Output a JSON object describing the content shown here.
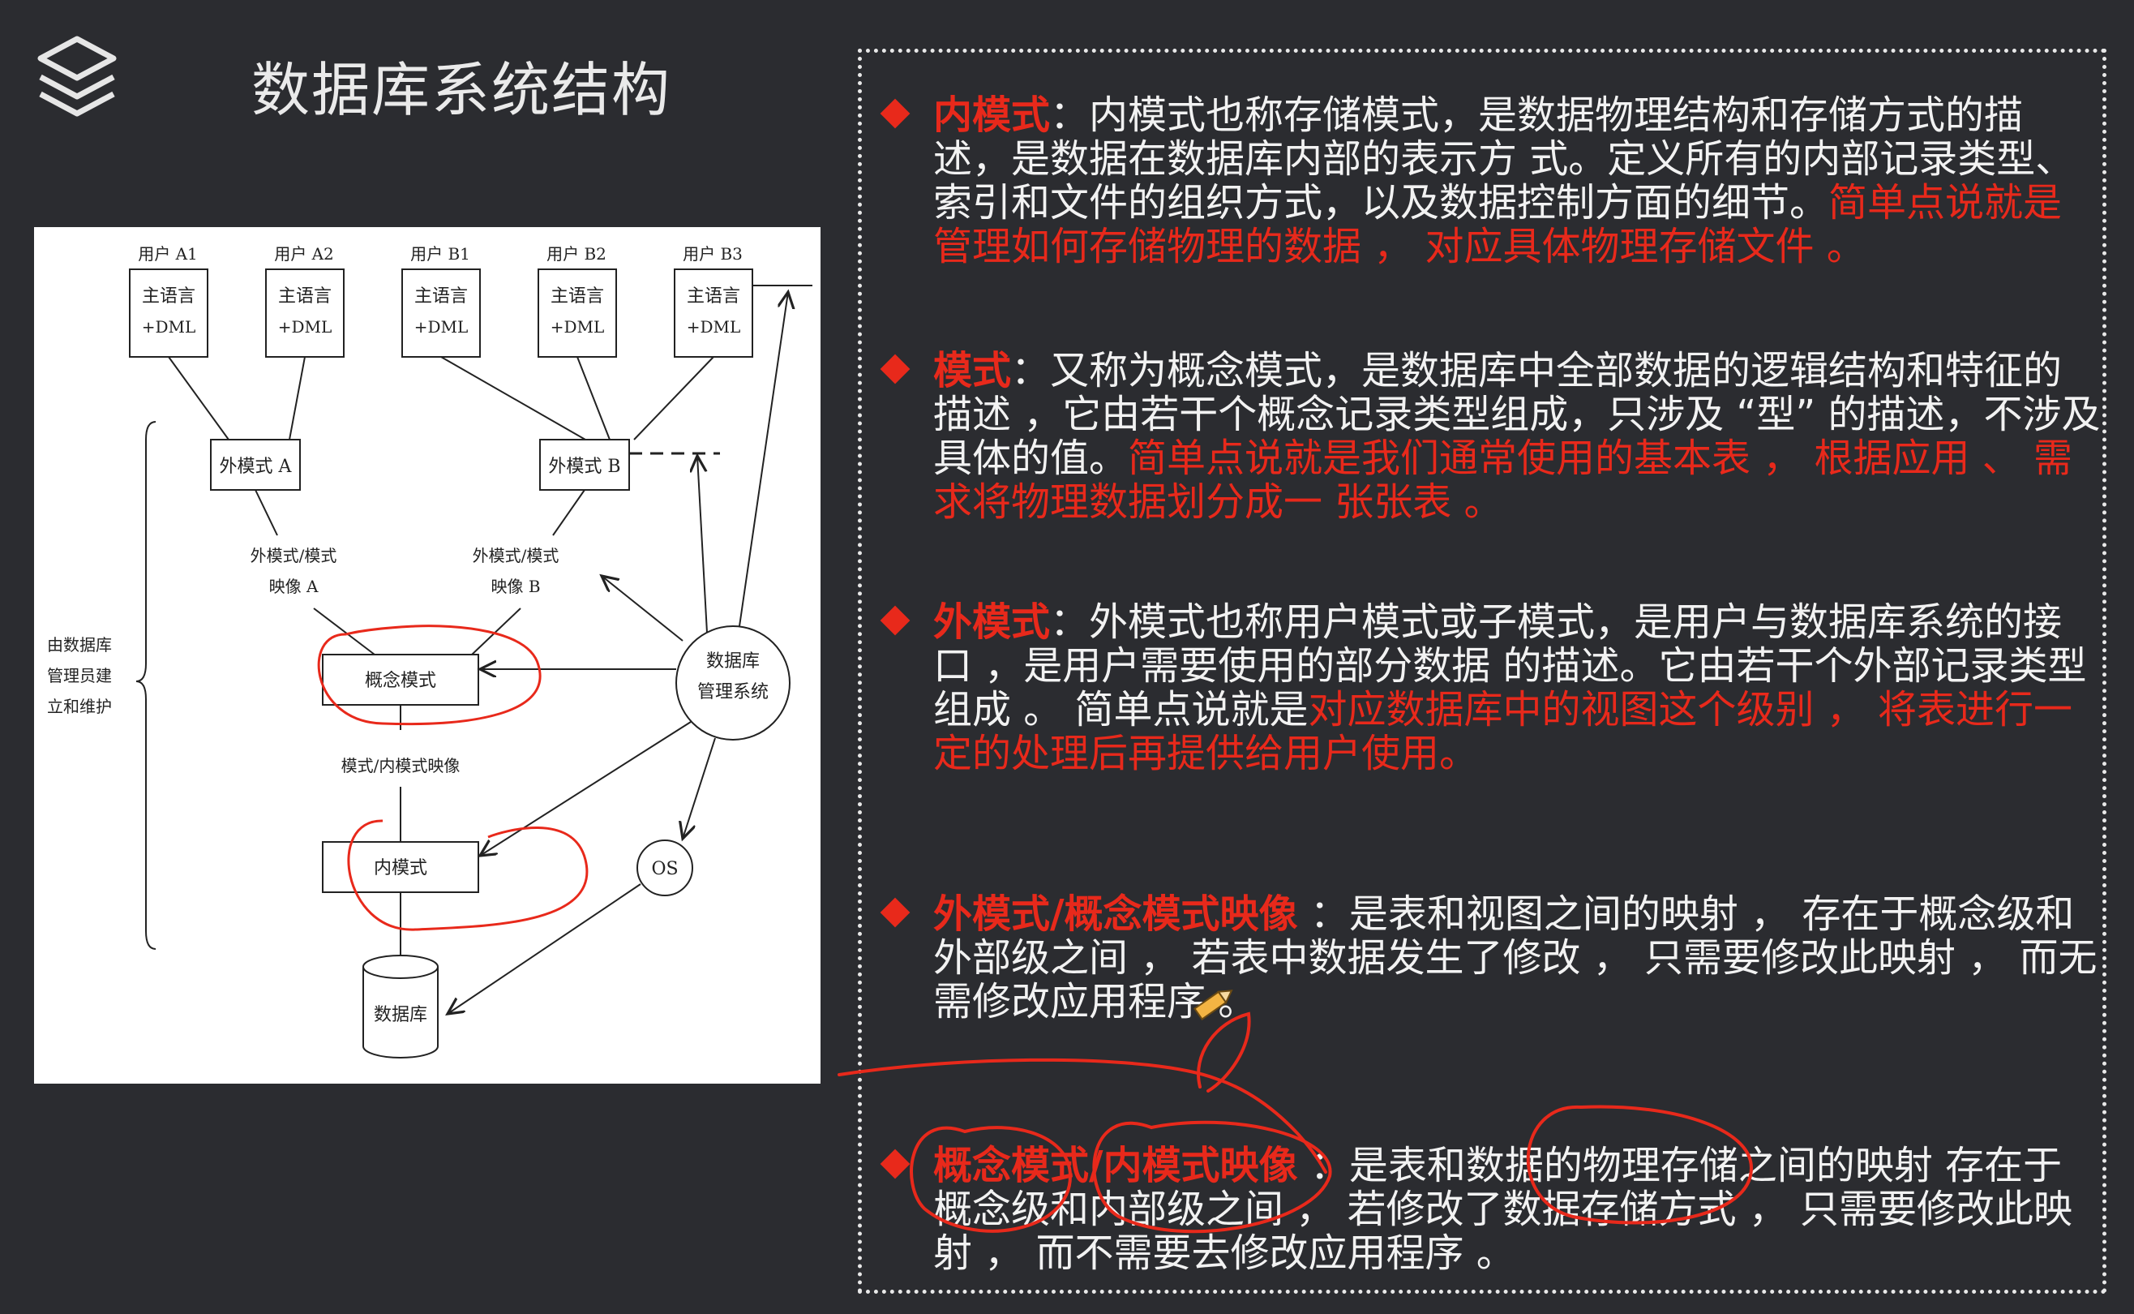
{
  "header": {
    "title": "数据库系统结构",
    "logo_icon": "layers-icon"
  },
  "diagram": {
    "users": [
      {
        "label": "用户 A1",
        "box_line1": "主语言",
        "box_line2": "+DML"
      },
      {
        "label": "用户 A2",
        "box_line1": "主语言",
        "box_line2": "+DML"
      },
      {
        "label": "用户 B1",
        "box_line1": "主语言",
        "box_line2": "+DML"
      },
      {
        "label": "用户 B2",
        "box_line1": "主语言",
        "box_line2": "+DML"
      },
      {
        "label": "用户 B3",
        "box_line1": "主语言",
        "box_line2": "+DML"
      }
    ],
    "external_a": "外模式 A",
    "external_b": "外模式 B",
    "mapping_a_line1": "外模式/模式",
    "mapping_a_line2": "映像 A",
    "mapping_b_line1": "外模式/模式",
    "mapping_b_line2": "映像 B",
    "conceptual": "概念模式",
    "conceptual_internal_mapping": "模式/内模式映像",
    "internal": "内模式",
    "database": "数据库",
    "os": "OS",
    "dbms_line1": "数据库",
    "dbms_line2": "管理系统",
    "admin_line1": "由数据库",
    "admin_line2": "管理员建",
    "admin_line3": "立和维护"
  },
  "notes": [
    {
      "term": "内模式",
      "sep": "：",
      "body": "内模式也称存储模式，是数据物理结构和存储方式的描述，是数据在数据库内部的表示方 式。定义所有的内部记录类型、索引和文件的组织方式，以及数据控制方面的细节。",
      "highlight": "简单点说就是管理如何存储物理的数据 ， 对应具体物理存储文件 。",
      "tail": ""
    },
    {
      "term": "模式",
      "sep": "：",
      "body": "又称为概念模式，是数据库中全部数据的逻辑结构和特征的描述 ，它由若干个概念记录类型组成，只涉及 “型” 的描述，不涉及具体的值。",
      "highlight": "简单点说就是我们通常使用的基本表 ， 根据应用 、 需求将物理数据划分成一 张张表 。",
      "tail": ""
    },
    {
      "term": "外模式",
      "sep": "：",
      "body": "外模式也称用户模式或子模式，是用户与数据库系统的接口 ，是用户需要使用的部分数据 的描述。它由若干个外部记录类型组成 。 简单点说就是",
      "highlight": "对应数据库中的视图这个级别 ， 将表进行一定的处理后再提供给用户使用。",
      "tail": ""
    },
    {
      "term": "外模式/概念模式映像",
      "sep": " ：",
      "body": "是表和视图之间的映射 ， 存在于概念级和外部级之间 ， 若表中数据发生了修改 ， 只需要修改此映射 ， 而无需修改应用程序 。",
      "highlight": "",
      "tail": ""
    },
    {
      "term": "概念模式/内模式映像",
      "sep": " ：",
      "body": "是表和数据的物理存储之间的映射 存在于概念级和内部级之间 ， 若修改了数据存储方式 ， 只需要修改此映射 ， 而不需要去修改应用程序 。",
      "highlight": "",
      "tail": ""
    }
  ],
  "colors": {
    "background": "#2b2c30",
    "accent_red": "#e8291b",
    "text": "#f2f2f2"
  }
}
